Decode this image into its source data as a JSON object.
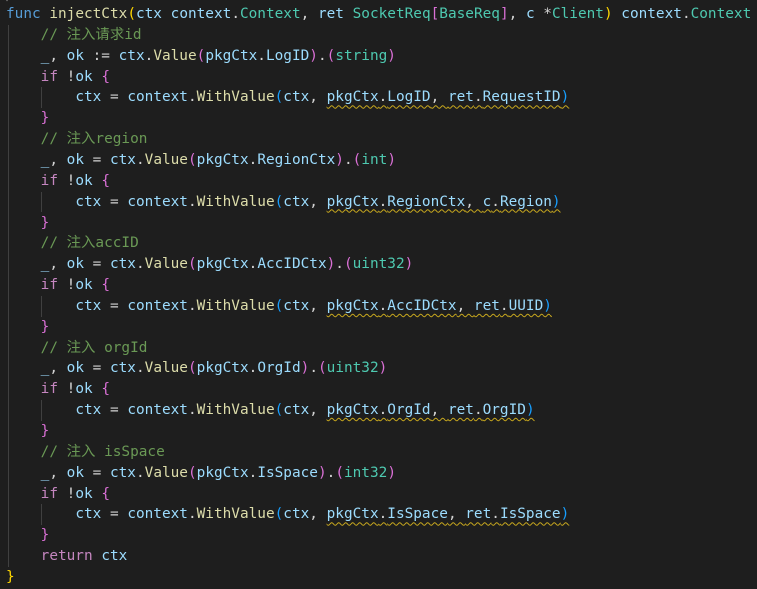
{
  "editor": {
    "language": "go",
    "theme": {
      "background": "#1e1e1e",
      "keyword": "#569cd6",
      "control": "#c586c0",
      "function": "#dcdcaa",
      "type": "#4ec9b0",
      "variable": "#9cdcfe",
      "comment": "#6a9955",
      "bracket1": "#ffd700",
      "bracket2": "#da70d6",
      "bracket3": "#179fff",
      "warning_squiggle": "#c8a81e"
    },
    "lines": [
      [
        [
          "kw",
          "func"
        ],
        [
          "txt",
          " "
        ],
        [
          "fn",
          "injectCtx"
        ],
        [
          "br1",
          "("
        ],
        [
          "var",
          "ctx"
        ],
        [
          "txt",
          " "
        ],
        [
          "var",
          "context"
        ],
        [
          "txt",
          "."
        ],
        [
          "type",
          "Context"
        ],
        [
          "txt",
          ", "
        ],
        [
          "var",
          "ret"
        ],
        [
          "txt",
          " "
        ],
        [
          "type",
          "SocketReq"
        ],
        [
          "br2",
          "["
        ],
        [
          "type",
          "BaseReq"
        ],
        [
          "br2",
          "]"
        ],
        [
          "txt",
          ", "
        ],
        [
          "var",
          "c"
        ],
        [
          "txt",
          " *"
        ],
        [
          "type",
          "Client"
        ],
        [
          "br1",
          ")"
        ],
        [
          "txt",
          " "
        ],
        [
          "var",
          "context"
        ],
        [
          "txt",
          "."
        ],
        [
          "type",
          "Context"
        ],
        [
          "txt",
          " "
        ],
        [
          "br1",
          "{"
        ]
      ],
      [
        [
          "txt",
          "    "
        ],
        [
          "cmt",
          "// 注入请求id"
        ]
      ],
      [
        [
          "txt",
          "    "
        ],
        [
          "var",
          "_"
        ],
        [
          "txt",
          ", "
        ],
        [
          "var",
          "ok"
        ],
        [
          "txt",
          " := "
        ],
        [
          "var",
          "ctx"
        ],
        [
          "txt",
          "."
        ],
        [
          "fn",
          "Value"
        ],
        [
          "br2",
          "("
        ],
        [
          "var",
          "pkgCtx"
        ],
        [
          "txt",
          "."
        ],
        [
          "var",
          "LogID"
        ],
        [
          "br2",
          ")"
        ],
        [
          "txt",
          "."
        ],
        [
          "br2",
          "("
        ],
        [
          "type",
          "string"
        ],
        [
          "br2",
          ")"
        ]
      ],
      [
        [
          "txt",
          "    "
        ],
        [
          "ctl",
          "if"
        ],
        [
          "txt",
          " !"
        ],
        [
          "var",
          "ok"
        ],
        [
          "txt",
          " "
        ],
        [
          "br2",
          "{"
        ]
      ],
      [
        [
          "txt",
          "        "
        ],
        [
          "var",
          "ctx"
        ],
        [
          "txt",
          " = "
        ],
        [
          "var",
          "context"
        ],
        [
          "txt",
          "."
        ],
        [
          "fn",
          "WithValue"
        ],
        [
          "br3",
          "("
        ],
        [
          "var",
          "ctx"
        ],
        [
          "txt",
          ", "
        ],
        [
          "var",
          "pkgCtx",
          "sq"
        ],
        [
          "txt",
          ".",
          "sq"
        ],
        [
          "var",
          "LogID",
          "sq"
        ],
        [
          "txt",
          ", ",
          "sq"
        ],
        [
          "var",
          "ret",
          "sq"
        ],
        [
          "txt",
          ".",
          "sq"
        ],
        [
          "var",
          "RequestID",
          "sq"
        ],
        [
          "br3",
          ")",
          "sq"
        ]
      ],
      [
        [
          "txt",
          "    "
        ],
        [
          "br2",
          "}"
        ]
      ],
      [
        [
          "txt",
          "    "
        ],
        [
          "cmt",
          "// 注入region"
        ]
      ],
      [
        [
          "txt",
          "    "
        ],
        [
          "var",
          "_"
        ],
        [
          "txt",
          ", "
        ],
        [
          "var",
          "ok"
        ],
        [
          "txt",
          " = "
        ],
        [
          "var",
          "ctx"
        ],
        [
          "txt",
          "."
        ],
        [
          "fn",
          "Value"
        ],
        [
          "br2",
          "("
        ],
        [
          "var",
          "pkgCtx"
        ],
        [
          "txt",
          "."
        ],
        [
          "var",
          "RegionCtx"
        ],
        [
          "br2",
          ")"
        ],
        [
          "txt",
          "."
        ],
        [
          "br2",
          "("
        ],
        [
          "type",
          "int"
        ],
        [
          "br2",
          ")"
        ]
      ],
      [
        [
          "txt",
          "    "
        ],
        [
          "ctl",
          "if"
        ],
        [
          "txt",
          " !"
        ],
        [
          "var",
          "ok"
        ],
        [
          "txt",
          " "
        ],
        [
          "br2",
          "{"
        ]
      ],
      [
        [
          "txt",
          "        "
        ],
        [
          "var",
          "ctx"
        ],
        [
          "txt",
          " = "
        ],
        [
          "var",
          "context"
        ],
        [
          "txt",
          "."
        ],
        [
          "fn",
          "WithValue"
        ],
        [
          "br3",
          "("
        ],
        [
          "var",
          "ctx"
        ],
        [
          "txt",
          ", "
        ],
        [
          "var",
          "pkgCtx",
          "sq"
        ],
        [
          "txt",
          ".",
          "sq"
        ],
        [
          "var",
          "RegionCtx",
          "sq"
        ],
        [
          "txt",
          ", ",
          "sq"
        ],
        [
          "var",
          "c",
          "sq"
        ],
        [
          "txt",
          ".",
          "sq"
        ],
        [
          "var",
          "Region",
          "sq"
        ],
        [
          "br3",
          ")",
          "sq"
        ]
      ],
      [
        [
          "txt",
          "    "
        ],
        [
          "br2",
          "}"
        ]
      ],
      [
        [
          "txt",
          "    "
        ],
        [
          "cmt",
          "// 注入accID"
        ]
      ],
      [
        [
          "txt",
          "    "
        ],
        [
          "var",
          "_"
        ],
        [
          "txt",
          ", "
        ],
        [
          "var",
          "ok"
        ],
        [
          "txt",
          " = "
        ],
        [
          "var",
          "ctx"
        ],
        [
          "txt",
          "."
        ],
        [
          "fn",
          "Value"
        ],
        [
          "br2",
          "("
        ],
        [
          "var",
          "pkgCtx"
        ],
        [
          "txt",
          "."
        ],
        [
          "var",
          "AccIDCtx"
        ],
        [
          "br2",
          ")"
        ],
        [
          "txt",
          "."
        ],
        [
          "br2",
          "("
        ],
        [
          "type",
          "uint32"
        ],
        [
          "br2",
          ")"
        ]
      ],
      [
        [
          "txt",
          "    "
        ],
        [
          "ctl",
          "if"
        ],
        [
          "txt",
          " !"
        ],
        [
          "var",
          "ok"
        ],
        [
          "txt",
          " "
        ],
        [
          "br2",
          "{"
        ]
      ],
      [
        [
          "txt",
          "        "
        ],
        [
          "var",
          "ctx"
        ],
        [
          "txt",
          " = "
        ],
        [
          "var",
          "context"
        ],
        [
          "txt",
          "."
        ],
        [
          "fn",
          "WithValue"
        ],
        [
          "br3",
          "("
        ],
        [
          "var",
          "ctx"
        ],
        [
          "txt",
          ", "
        ],
        [
          "var",
          "pkgCtx",
          "sq"
        ],
        [
          "txt",
          ".",
          "sq"
        ],
        [
          "var",
          "AccIDCtx",
          "sq"
        ],
        [
          "txt",
          ", ",
          "sq"
        ],
        [
          "var",
          "ret",
          "sq"
        ],
        [
          "txt",
          ".",
          "sq"
        ],
        [
          "var",
          "UUID",
          "sq"
        ],
        [
          "br3",
          ")",
          "sq"
        ]
      ],
      [
        [
          "txt",
          "    "
        ],
        [
          "br2",
          "}"
        ]
      ],
      [
        [
          "txt",
          "    "
        ],
        [
          "cmt",
          "// 注入 orgId"
        ]
      ],
      [
        [
          "txt",
          "    "
        ],
        [
          "var",
          "_"
        ],
        [
          "txt",
          ", "
        ],
        [
          "var",
          "ok"
        ],
        [
          "txt",
          " = "
        ],
        [
          "var",
          "ctx"
        ],
        [
          "txt",
          "."
        ],
        [
          "fn",
          "Value"
        ],
        [
          "br2",
          "("
        ],
        [
          "var",
          "pkgCtx"
        ],
        [
          "txt",
          "."
        ],
        [
          "var",
          "OrgId"
        ],
        [
          "br2",
          ")"
        ],
        [
          "txt",
          "."
        ],
        [
          "br2",
          "("
        ],
        [
          "type",
          "uint32"
        ],
        [
          "br2",
          ")"
        ]
      ],
      [
        [
          "txt",
          "    "
        ],
        [
          "ctl",
          "if"
        ],
        [
          "txt",
          " !"
        ],
        [
          "var",
          "ok"
        ],
        [
          "txt",
          " "
        ],
        [
          "br2",
          "{"
        ]
      ],
      [
        [
          "txt",
          "        "
        ],
        [
          "var",
          "ctx"
        ],
        [
          "txt",
          " = "
        ],
        [
          "var",
          "context"
        ],
        [
          "txt",
          "."
        ],
        [
          "fn",
          "WithValue"
        ],
        [
          "br3",
          "("
        ],
        [
          "var",
          "ctx"
        ],
        [
          "txt",
          ", "
        ],
        [
          "var",
          "pkgCtx",
          "sq"
        ],
        [
          "txt",
          ".",
          "sq"
        ],
        [
          "var",
          "OrgId",
          "sq"
        ],
        [
          "txt",
          ", ",
          "sq"
        ],
        [
          "var",
          "ret",
          "sq"
        ],
        [
          "txt",
          ".",
          "sq"
        ],
        [
          "var",
          "OrgID",
          "sq"
        ],
        [
          "br3",
          ")",
          "sq"
        ]
      ],
      [
        [
          "txt",
          "    "
        ],
        [
          "br2",
          "}"
        ]
      ],
      [
        [
          "txt",
          "    "
        ],
        [
          "cmt",
          "// 注入 isSpace"
        ]
      ],
      [
        [
          "txt",
          "    "
        ],
        [
          "var",
          "_"
        ],
        [
          "txt",
          ", "
        ],
        [
          "var",
          "ok"
        ],
        [
          "txt",
          " = "
        ],
        [
          "var",
          "ctx"
        ],
        [
          "txt",
          "."
        ],
        [
          "fn",
          "Value"
        ],
        [
          "br2",
          "("
        ],
        [
          "var",
          "pkgCtx"
        ],
        [
          "txt",
          "."
        ],
        [
          "var",
          "IsSpace"
        ],
        [
          "br2",
          ")"
        ],
        [
          "txt",
          "."
        ],
        [
          "br2",
          "("
        ],
        [
          "type",
          "int32"
        ],
        [
          "br2",
          ")"
        ]
      ],
      [
        [
          "txt",
          "    "
        ],
        [
          "ctl",
          "if"
        ],
        [
          "txt",
          " !"
        ],
        [
          "var",
          "ok"
        ],
        [
          "txt",
          " "
        ],
        [
          "br2",
          "{"
        ]
      ],
      [
        [
          "txt",
          "        "
        ],
        [
          "var",
          "ctx"
        ],
        [
          "txt",
          " = "
        ],
        [
          "var",
          "context"
        ],
        [
          "txt",
          "."
        ],
        [
          "fn",
          "WithValue"
        ],
        [
          "br3",
          "("
        ],
        [
          "var",
          "ctx"
        ],
        [
          "txt",
          ", "
        ],
        [
          "var",
          "pkgCtx",
          "sq"
        ],
        [
          "txt",
          ".",
          "sq"
        ],
        [
          "var",
          "IsSpace",
          "sq"
        ],
        [
          "txt",
          ", ",
          "sq"
        ],
        [
          "var",
          "ret",
          "sq"
        ],
        [
          "txt",
          ".",
          "sq"
        ],
        [
          "var",
          "IsSpace",
          "sq"
        ],
        [
          "br3",
          ")",
          "sq"
        ]
      ],
      [
        [
          "txt",
          "    "
        ],
        [
          "br2",
          "}"
        ]
      ],
      [
        [
          "txt",
          "    "
        ],
        [
          "ctl",
          "return"
        ],
        [
          "txt",
          " "
        ],
        [
          "var",
          "ctx"
        ]
      ],
      [
        [
          "br1",
          "}"
        ]
      ]
    ]
  }
}
